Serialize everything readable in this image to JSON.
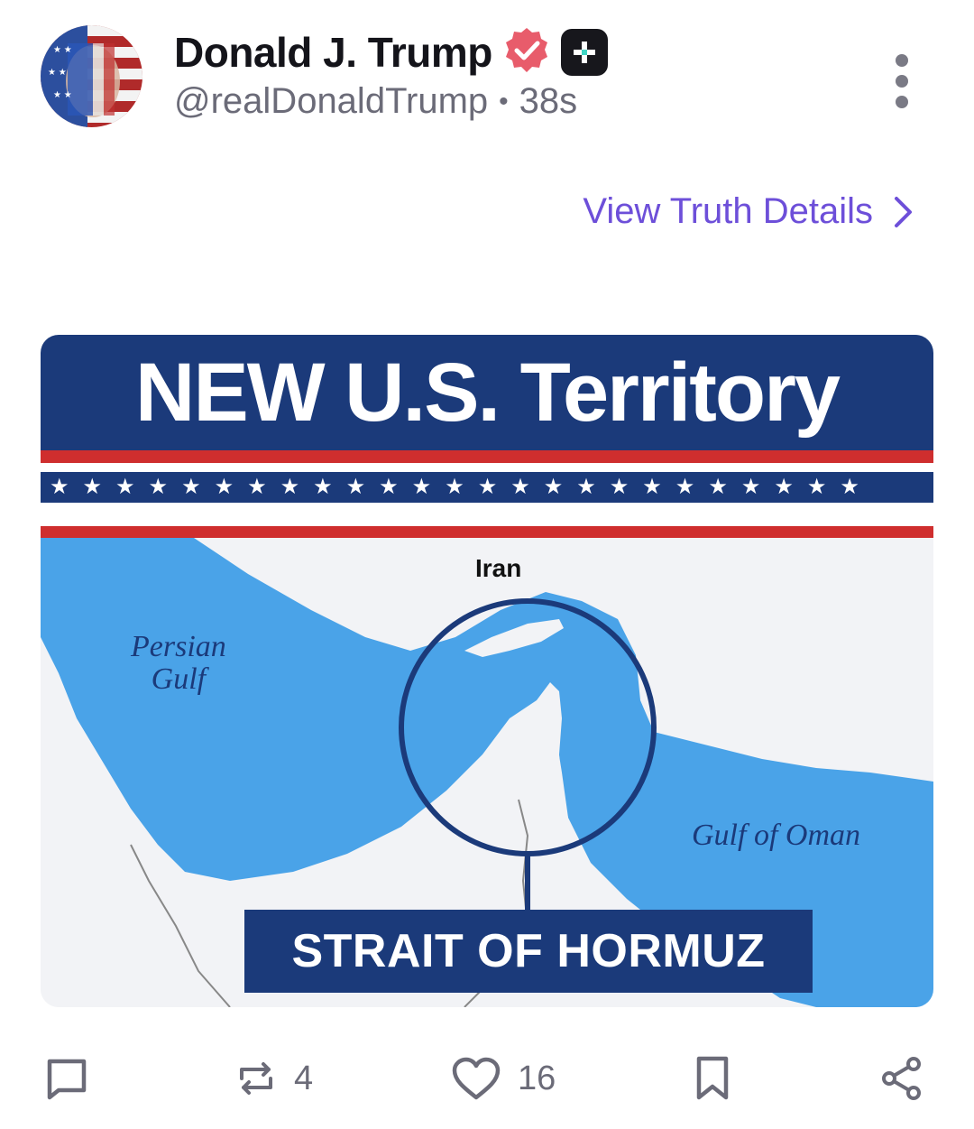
{
  "post": {
    "author_name": "Donald J. Trump",
    "handle": "@realDonaldTrump",
    "separator": "•",
    "timestamp": "38s",
    "details_link": "View Truth Details"
  },
  "media": {
    "title": "NEW U.S. Territory",
    "stars": "★★★★★★★★★★★★★★★★★★★★★★★★★",
    "labels": {
      "iran": "Iran",
      "persian_gulf_line1": "Persian",
      "persian_gulf_line2": "Gulf",
      "gulf_of_oman": "Gulf of Oman",
      "strait": "STRAIT OF HORMUZ"
    }
  },
  "actions": {
    "reply_count": "",
    "retruth_count": "4",
    "like_count": "16"
  },
  "icons": {
    "verified": "verified-badge-icon",
    "plus": "plus-badge-icon",
    "more": "more-vertical-icon",
    "reply": "reply-icon",
    "retruth": "retruth-icon",
    "like": "heart-icon",
    "bookmark": "bookmark-icon",
    "share": "share-icon"
  },
  "colors": {
    "accent": "#6d4fd9",
    "verified": "#e85c6b",
    "banner_blue": "#1b3a7a",
    "flag_red": "#cf2e2e",
    "water": "#4aa3e8"
  }
}
